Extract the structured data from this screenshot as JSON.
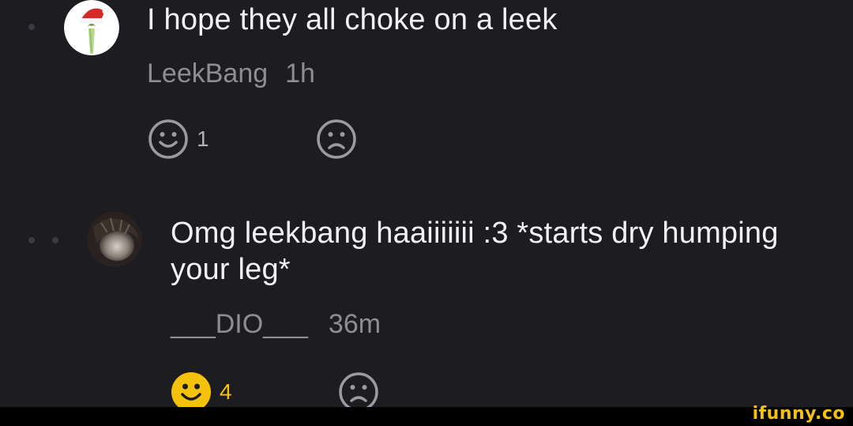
{
  "comments": [
    {
      "text": "I hope they all choke on a leek",
      "author": "LeekBang",
      "time": "1h",
      "like_count": "1",
      "avatar_icon": "santa-hat-leek-avatar"
    },
    {
      "text_line1": "Omg leekbang haaiiiiiii :3 *starts dry humping",
      "text_line2": "your leg*",
      "author": "___DIO___",
      "time": "36m",
      "like_count": "4",
      "avatar_icon": "dark-portrait-avatar"
    }
  ],
  "brand": {
    "label": "ifunny.co",
    "color": "#f4c20d"
  }
}
